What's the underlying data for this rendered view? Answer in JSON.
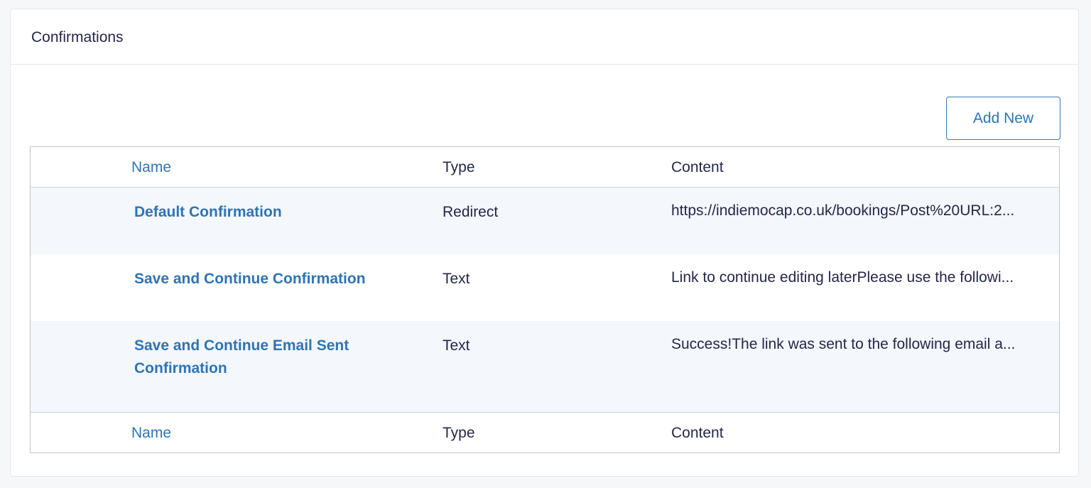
{
  "panel": {
    "title": "Confirmations",
    "add_new_label": "Add New"
  },
  "table": {
    "header": {
      "name": "Name",
      "type": "Type",
      "content": "Content"
    },
    "rows": [
      {
        "name": "Default Confirmation",
        "type": "Redirect",
        "content": "https://indiemocap.co.uk/bookings/Post%20URL:2..."
      },
      {
        "name": "Save and Continue Confirmation",
        "type": "Text",
        "content": "Link to continue editing laterPlease use the followi..."
      },
      {
        "name": "Save and Continue Email Sent Confirmation",
        "type": "Text",
        "content": "Success!The link was sent to the following email a..."
      }
    ],
    "footer": {
      "name": "Name",
      "type": "Type",
      "content": "Content"
    }
  },
  "colors": {
    "accent": "#2e74b5",
    "text": "#242748",
    "row_alt": "#f4f7fb",
    "border": "#c3c4c7"
  }
}
